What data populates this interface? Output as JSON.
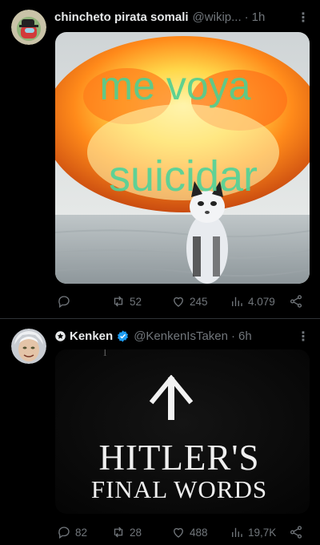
{
  "tweets": [
    {
      "name": "chincheto pirata somali",
      "handle": "@wikip...",
      "time": "1h",
      "image_text": {
        "line1": "me voya",
        "line2": "suicidar"
      },
      "stats": {
        "replies": "",
        "reposts": "52",
        "likes": "245",
        "views": "4.079"
      }
    },
    {
      "name": "Kenken",
      "handle": "@KenkenIsTaken",
      "time": "6h",
      "image_text": {
        "line1": "HITLER'S",
        "line2": "FINAL WORDS"
      },
      "stats": {
        "replies": "82",
        "reposts": "28",
        "likes": "488",
        "views": "19,7K"
      }
    }
  ],
  "colors": {
    "background": "#000000",
    "muted": "#71767b",
    "verified": "#1d9bf0"
  }
}
